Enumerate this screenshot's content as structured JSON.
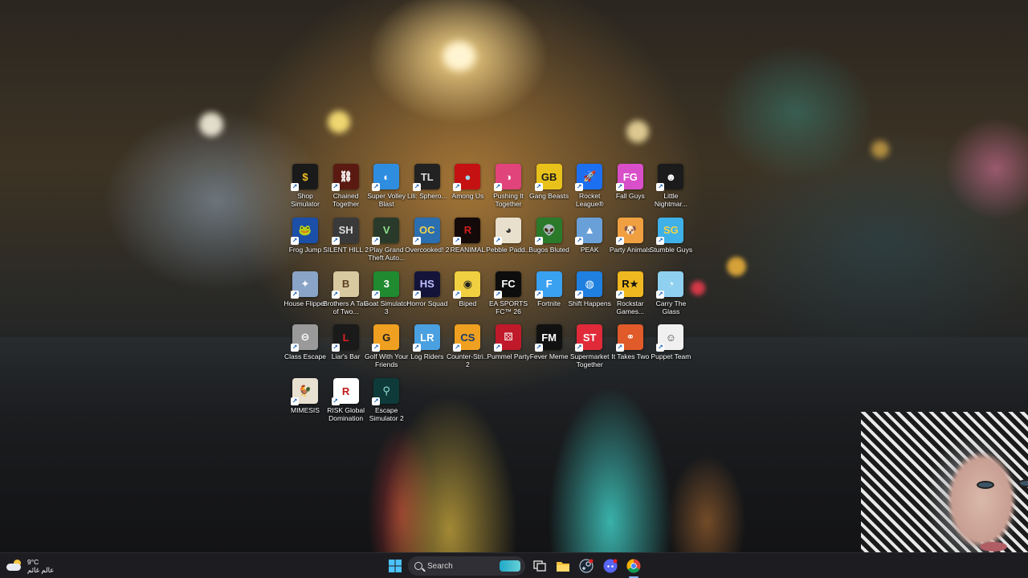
{
  "desktop": {
    "icons": [
      {
        "label": "Shop Simulator",
        "icon": "shop-simulator-icon",
        "bg": "#1a1a1a",
        "fg": "#f0c020",
        "glyph": "$"
      },
      {
        "label": "Chained Together",
        "icon": "chained-together-icon",
        "bg": "#5a1a12",
        "fg": "#ffffff",
        "glyph": "⛓"
      },
      {
        "label": "Super Volley Blast",
        "icon": "super-volley-blast-icon",
        "bg": "#2f8de0",
        "fg": "#ffffff",
        "glyph": "◐"
      },
      {
        "label": "Lili: Sphero...",
        "icon": "lili-sphero-icon",
        "bg": "#222222",
        "fg": "#dddddd",
        "glyph": "TL"
      },
      {
        "label": "Among Us",
        "icon": "among-us-icon",
        "bg": "#c51111",
        "fg": "#9fd6f0",
        "glyph": "●"
      },
      {
        "label": "Pushing It Together",
        "icon": "pushing-it-together-icon",
        "bg": "#e0447a",
        "fg": "#ffffff",
        "glyph": "◑"
      },
      {
        "label": "Gang Beasts",
        "icon": "gang-beasts-icon",
        "bg": "#e8c21a",
        "fg": "#1a1a1a",
        "glyph": "GB"
      },
      {
        "label": "Rocket League®",
        "icon": "rocket-league-icon",
        "bg": "#1d6ff2",
        "fg": "#ffffff",
        "glyph": "🚀"
      },
      {
        "label": "Fall Guys",
        "icon": "fall-guys-icon",
        "bg": "#d94fc9",
        "fg": "#ffffff",
        "glyph": "FG"
      },
      {
        "label": "Little Nightmar...",
        "icon": "little-nightmares-icon",
        "bg": "#1b1b1b",
        "fg": "#ffffff",
        "glyph": "☻"
      },
      {
        "label": "Frog Jump",
        "icon": "frog-jump-icon",
        "bg": "#1c4fa8",
        "fg": "#7ef07e",
        "glyph": "🐸"
      },
      {
        "label": "SILENT HILL 2",
        "icon": "silent-hill-2-icon",
        "bg": "#3a3a3a",
        "fg": "#dddddd",
        "glyph": "SH"
      },
      {
        "label": "Play Grand Theft Auto...",
        "icon": "gta-icon",
        "bg": "#2a3a2a",
        "fg": "#8fe08f",
        "glyph": "V"
      },
      {
        "label": "Overcooked! 2",
        "icon": "overcooked-2-icon",
        "bg": "#2b6fb0",
        "fg": "#f3d34a",
        "glyph": "OC"
      },
      {
        "label": "REANIMAL",
        "icon": "reanimal-icon",
        "bg": "#150a0a",
        "fg": "#d02020",
        "glyph": "R"
      },
      {
        "label": "Pebble Padd...",
        "icon": "pebble-paddle-icon",
        "bg": "#e8e0cc",
        "fg": "#333333",
        "glyph": "◕"
      },
      {
        "label": "Bugos Bluted",
        "icon": "bugos-bluted-icon",
        "bg": "#2a7a2a",
        "fg": "#cfe8cf",
        "glyph": "👽"
      },
      {
        "label": "PEAK",
        "icon": "peak-icon",
        "bg": "#6aa0d8",
        "fg": "#ffffff",
        "glyph": "▲"
      },
      {
        "label": "Party Animals",
        "icon": "party-animals-icon",
        "bg": "#f0a040",
        "fg": "#ffffff",
        "glyph": "🐶"
      },
      {
        "label": "Stumble Guys",
        "icon": "stumble-guys-icon",
        "bg": "#3fb0e8",
        "fg": "#f3d34a",
        "glyph": "SG"
      },
      {
        "label": "House Flipper",
        "icon": "house-flipper-icon",
        "bg": "#8aa4c8",
        "fg": "#ffffff",
        "glyph": "✦"
      },
      {
        "label": "Brothers A Tale of Two...",
        "icon": "brothers-icon",
        "bg": "#d8c9a0",
        "fg": "#5a4020",
        "glyph": "B"
      },
      {
        "label": "Goat Simulator 3",
        "icon": "goat-simulator-3-icon",
        "bg": "#1f8a2f",
        "fg": "#ffffff",
        "glyph": "3"
      },
      {
        "label": "Horror Squad",
        "icon": "horror-squad-icon",
        "bg": "#14143a",
        "fg": "#c0c0ff",
        "glyph": "HS"
      },
      {
        "label": "Biped",
        "icon": "biped-icon",
        "bg": "#f0d040",
        "fg": "#202020",
        "glyph": "◉"
      },
      {
        "label": "EA SPORTS FC™ 26",
        "icon": "ea-fc-26-icon",
        "bg": "#0d0d0d",
        "fg": "#ffffff",
        "glyph": "FC"
      },
      {
        "label": "Fortnite",
        "icon": "fortnite-icon",
        "bg": "#3aa0f0",
        "fg": "#ffffff",
        "glyph": "F"
      },
      {
        "label": "Shift Happens",
        "icon": "shift-happens-icon",
        "bg": "#2080e0",
        "fg": "#ffffff",
        "glyph": "◍"
      },
      {
        "label": "Rockstar Games...",
        "icon": "rockstar-games-icon",
        "bg": "#f0b820",
        "fg": "#111111",
        "glyph": "R★"
      },
      {
        "label": "Carry The Glass",
        "icon": "carry-the-glass-icon",
        "bg": "#8fd0f0",
        "fg": "#ffffff",
        "glyph": "◔"
      },
      {
        "label": "Class Escape",
        "icon": "class-escape-icon",
        "bg": "#9a9a9a",
        "fg": "#ffffff",
        "glyph": "⊖"
      },
      {
        "label": "Liar's Bar",
        "icon": "liars-bar-icon",
        "bg": "#1a1a1a",
        "fg": "#e02020",
        "glyph": "L"
      },
      {
        "label": "Golf With Your Friends",
        "icon": "golf-with-your-friends-icon",
        "bg": "#f0a020",
        "fg": "#202020",
        "glyph": "G"
      },
      {
        "label": "Log Riders",
        "icon": "log-riders-icon",
        "bg": "#4aa0e0",
        "fg": "#ffffff",
        "glyph": "LR"
      },
      {
        "label": "Counter-Stri... 2",
        "icon": "counter-strike-2-icon",
        "bg": "#f0a020",
        "fg": "#1a3a6a",
        "glyph": "CS"
      },
      {
        "label": "Pummel Party",
        "icon": "pummel-party-icon",
        "bg": "#c01a2a",
        "fg": "#ffffff",
        "glyph": "⚄"
      },
      {
        "label": "Fever Meme",
        "icon": "fever-meme-icon",
        "bg": "#111111",
        "fg": "#ffffff",
        "glyph": "FM"
      },
      {
        "label": "Supermarket Together",
        "icon": "supermarket-together-icon",
        "bg": "#e02a3a",
        "fg": "#ffffff",
        "glyph": "ST"
      },
      {
        "label": "It Takes Two",
        "icon": "it-takes-two-icon",
        "bg": "#e05a2a",
        "fg": "#ffffff",
        "glyph": "⚭"
      },
      {
        "label": "Puppet Team",
        "icon": "puppet-team-icon",
        "bg": "#f0f0f0",
        "fg": "#444444",
        "glyph": "☺"
      },
      {
        "label": "MIMESIS",
        "icon": "mimesis-icon",
        "bg": "#e8e0d0",
        "fg": "#c02020",
        "glyph": "🐓"
      },
      {
        "label": "RISK Global Domination",
        "icon": "risk-icon",
        "bg": "#ffffff",
        "fg": "#c01a1a",
        "glyph": "R"
      },
      {
        "label": "Escape Simulator 2",
        "icon": "escape-simulator-2-icon",
        "bg": "#0e3a3a",
        "fg": "#8fe0d8",
        "glyph": "⚲"
      }
    ]
  },
  "taskbar": {
    "weather_temp": "9°C",
    "weather_text": "عالم غائم",
    "search_placeholder": "Search",
    "apps": [
      {
        "name": "start",
        "icon": "windows-start-icon"
      },
      {
        "name": "task-view",
        "icon": "task-view-icon"
      },
      {
        "name": "file-explorer",
        "icon": "folder-icon"
      },
      {
        "name": "steam",
        "icon": "steam-icon"
      },
      {
        "name": "discord",
        "icon": "discord-icon"
      },
      {
        "name": "chrome",
        "icon": "chrome-icon"
      }
    ]
  }
}
